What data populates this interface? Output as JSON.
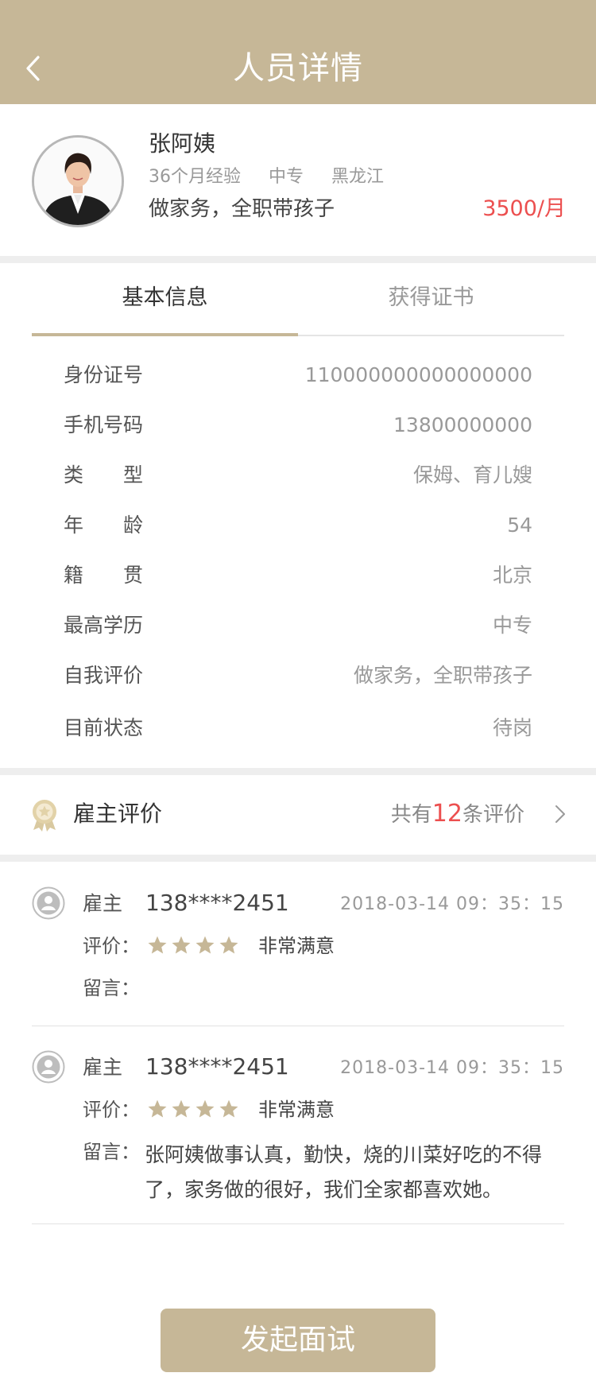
{
  "header": {
    "title": "人员详情"
  },
  "profile": {
    "name": "张阿姨",
    "experience": "36个月经验",
    "education": "中专",
    "hometown": "黑龙江",
    "skills": "做家务，全职带孩子",
    "salary": "3500/月"
  },
  "tabs": [
    {
      "label": "基本信息",
      "active": true
    },
    {
      "label": "获得证书",
      "active": false
    }
  ],
  "info": [
    {
      "label": "身份证号",
      "value": "110000000000000000"
    },
    {
      "label": "手机号码",
      "value": "13800000000"
    },
    {
      "label": "类　　型",
      "value": "保姆、育儿嫂"
    },
    {
      "label": "年　　龄",
      "value": "54"
    },
    {
      "label": "籍　　贯",
      "value": "北京"
    },
    {
      "label": "最高学历",
      "value": "中专"
    },
    {
      "label": "自我评价",
      "value": "做家务，全职带孩子"
    },
    {
      "label": "目前状态",
      "value": "待岗"
    }
  ],
  "reviews_section": {
    "title": "雇主评价",
    "count_prefix": "共有",
    "count": "12",
    "count_suffix": "条评价"
  },
  "reviews": [
    {
      "role": "雇主",
      "phone": "138****2451",
      "time": "2018-03-14  09：35：15",
      "rating_label": "评价：",
      "stars": 4,
      "rating_text": "非常满意",
      "message_label": "留言：",
      "message": ""
    },
    {
      "role": "雇主",
      "phone": "138****2451",
      "time": "2018-03-14  09：35：15",
      "rating_label": "评价：",
      "stars": 4,
      "rating_text": "非常满意",
      "message_label": "留言：",
      "message": "张阿姨做事认真，勤快，烧的川菜好吃的不得了，家务做的很好，我们全家都喜欢她。"
    }
  ],
  "cta": {
    "label": "发起面试"
  },
  "colors": {
    "accent": "#c6b797",
    "price": "#ec4f4f",
    "gap": "#eeeeee"
  }
}
